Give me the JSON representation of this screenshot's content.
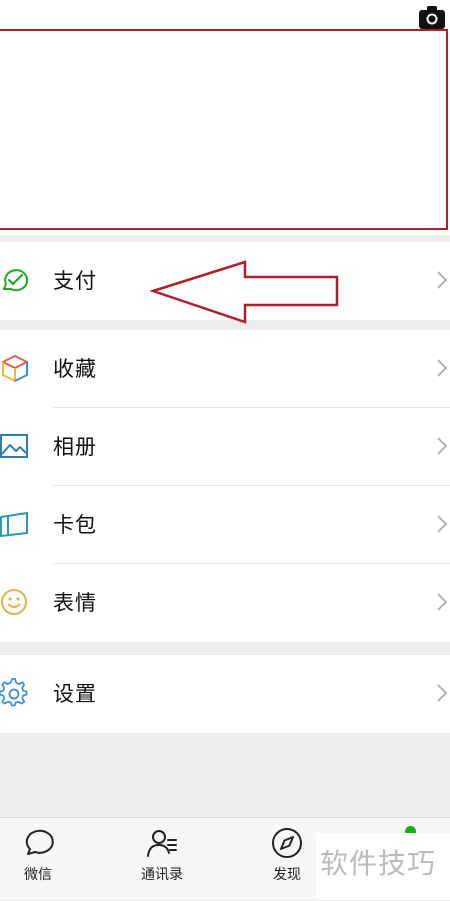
{
  "menu": {
    "pay": {
      "label": "支付",
      "icon": "wechat-pay-icon"
    },
    "items": [
      {
        "label": "收藏",
        "icon": "favorites-cube-icon"
      },
      {
        "label": "相册",
        "icon": "album-image-icon"
      },
      {
        "label": "卡包",
        "icon": "card-wallet-icon"
      },
      {
        "label": "表情",
        "icon": "smiley-icon"
      }
    ],
    "settings": {
      "label": "设置",
      "icon": "gear-icon"
    }
  },
  "tabbar": {
    "tabs": [
      {
        "label": "微信",
        "icon": "chat-bubble-icon"
      },
      {
        "label": "通讯录",
        "icon": "contacts-icon"
      },
      {
        "label": "发现",
        "icon": "compass-icon"
      }
    ]
  },
  "watermark": "软件技巧",
  "colors": {
    "annotation_red": "#b0202a",
    "pay_green": "#1aad19",
    "background": "#ededed"
  }
}
